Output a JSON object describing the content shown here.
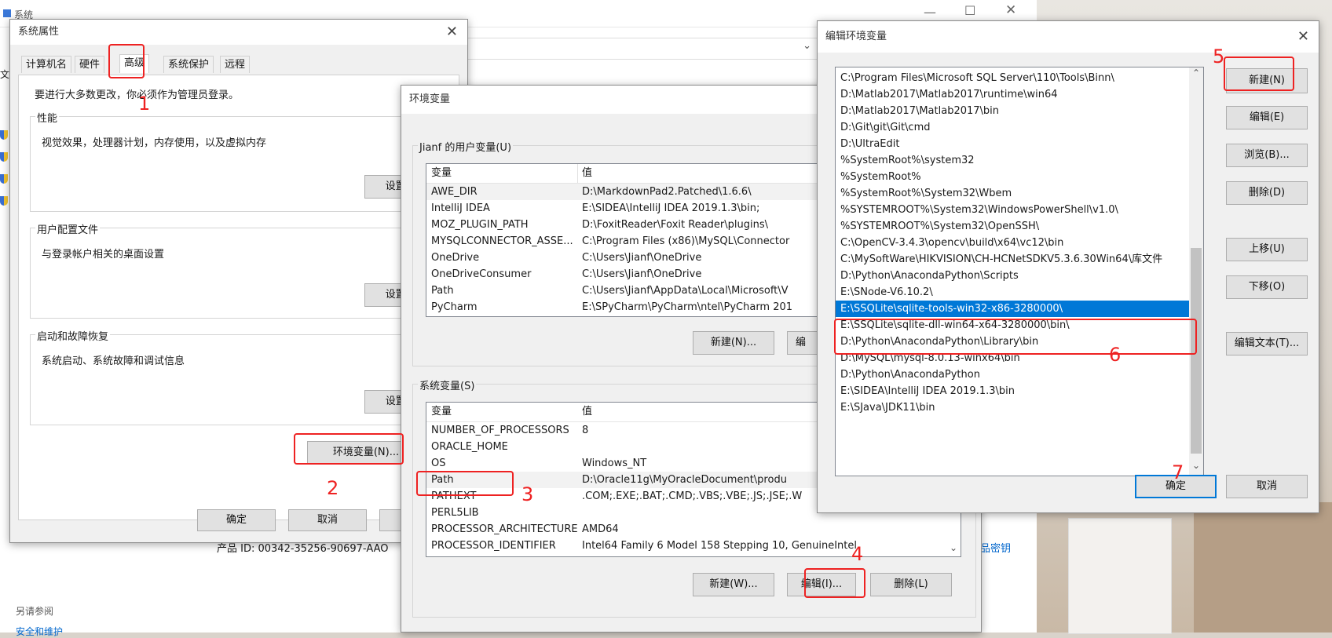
{
  "background_window": {
    "title": "系统",
    "product_id": "产品 ID: 00342-35256-90697-AAO",
    "change_key": "品密钥",
    "see_also": "另请参阅",
    "security": "安全和维护",
    "side_text": "文"
  },
  "sysprops": {
    "title": "系统属性",
    "tabs": [
      "计算机名",
      "硬件",
      "高级",
      "系统保护",
      "远程"
    ],
    "active_tab": "高级",
    "admin_note": "要进行大多数更改，你必须作为管理员登录。",
    "perf": {
      "label": "性能",
      "desc": "视觉效果，处理器计划，内存使用，以及虚拟内存",
      "button": "设置(S)..."
    },
    "profile": {
      "label": "用户配置文件",
      "desc": "与登录帐户相关的桌面设置",
      "button": "设置(E)..."
    },
    "startup": {
      "label": "启动和故障恢复",
      "desc": "系统启动、系统故障和调试信息",
      "button": "设置(T)..."
    },
    "env_button": "环境变量(N)...",
    "ok": "确定",
    "cancel": "取消"
  },
  "envvars": {
    "title": "环境变量",
    "user_group_label": "Jianf 的用户变量(U)",
    "col_var": "变量",
    "col_val": "值",
    "user_rows": [
      {
        "name": "AWE_DIR",
        "value": "D:\\MarkdownPad2.Patched\\1.6.6\\"
      },
      {
        "name": "IntelliJ IDEA",
        "value": "E:\\SIDEA\\IntelliJ IDEA 2019.1.3\\bin;"
      },
      {
        "name": "MOZ_PLUGIN_PATH",
        "value": "D:\\FoxitReader\\Foxit Reader\\plugins\\"
      },
      {
        "name": "MYSQLCONNECTOR_ASSE...",
        "value": "C:\\Program Files (x86)\\MySQL\\Connector"
      },
      {
        "name": "OneDrive",
        "value": "C:\\Users\\Jianf\\OneDrive"
      },
      {
        "name": "OneDriveConsumer",
        "value": "C:\\Users\\Jianf\\OneDrive"
      },
      {
        "name": "Path",
        "value": "C:\\Users\\Jianf\\AppData\\Local\\Microsoft\\V"
      },
      {
        "name": "PyCharm",
        "value": "E:\\SPyCharm\\PyCharm\\ntel\\PyCharm 201"
      }
    ],
    "user_new": "新建(N)...",
    "user_edit": "编",
    "sys_group_label": "系统变量(S)",
    "sys_rows": [
      {
        "name": "NUMBER_OF_PROCESSORS",
        "value": "8"
      },
      {
        "name": "ORACLE_HOME",
        "value": ""
      },
      {
        "name": "OS",
        "value": "Windows_NT"
      },
      {
        "name": "Path",
        "value": "D:\\Oracle11g\\MyOracleDocument\\produ"
      },
      {
        "name": "PATHEXT",
        "value": ".COM;.EXE;.BAT;.CMD;.VBS;.VBE;.JS;.JSE;.W"
      },
      {
        "name": "PERL5LIB",
        "value": ""
      },
      {
        "name": "PROCESSOR_ARCHITECTURE",
        "value": "AMD64"
      },
      {
        "name": "PROCESSOR_IDENTIFIER",
        "value": "Intel64 Family 6 Model 158 Stepping 10, GenuineIntel"
      }
    ],
    "sys_new": "新建(W)...",
    "sys_edit": "编辑(I)...",
    "sys_delete": "删除(L)"
  },
  "editenv": {
    "title": "编辑环境变量",
    "paths": [
      "C:\\Program Files\\Microsoft SQL Server\\110\\Tools\\Binn\\",
      "D:\\Matlab2017\\Matlab2017\\runtime\\win64",
      "D:\\Matlab2017\\Matlab2017\\bin",
      "D:\\Git\\git\\Git\\cmd",
      "D:\\UltraEdit",
      "%SystemRoot%\\system32",
      "%SystemRoot%",
      "%SystemRoot%\\System32\\Wbem",
      "%SYSTEMROOT%\\System32\\WindowsPowerShell\\v1.0\\",
      "%SYSTEMROOT%\\System32\\OpenSSH\\",
      "C:\\OpenCV-3.4.3\\opencv\\build\\x64\\vc12\\bin",
      "C:\\MySoftWare\\HIKVISION\\CH-HCNetSDKV5.3.6.30Win64\\库文件",
      "D:\\Python\\AnacondaPython\\Scripts",
      "E:\\SNode-V6.10.2\\",
      "E:\\SSQLite\\sqlite-tools-win32-x86-3280000\\",
      "E:\\SSQLite\\sqlite-dll-win64-x64-3280000\\bin\\",
      "D:\\Python\\AnacondaPython\\Library\\bin",
      "D:\\MySQL\\mysql-8.0.13-winx64\\bin",
      "D:\\Python\\AnacondaPython",
      "E:\\SIDEA\\IntelliJ IDEA 2019.1.3\\bin",
      "E:\\SJava\\JDK11\\bin"
    ],
    "selected_index": 14,
    "buttons": {
      "new": "新建(N)",
      "edit": "编辑(E)",
      "browse": "浏览(B)...",
      "delete": "删除(D)",
      "up": "上移(U)",
      "down": "下移(O)",
      "edit_text": "编辑文本(T)..."
    },
    "ok": "确定",
    "cancel": "取消"
  },
  "annotations": [
    "1",
    "2",
    "3",
    "4",
    "5",
    "6",
    "7"
  ],
  "colors": {
    "annotation": "#e22222",
    "selection": "#0078d7",
    "title_bg": "#ffffff",
    "dialog_bg": "#f0f0f0"
  }
}
